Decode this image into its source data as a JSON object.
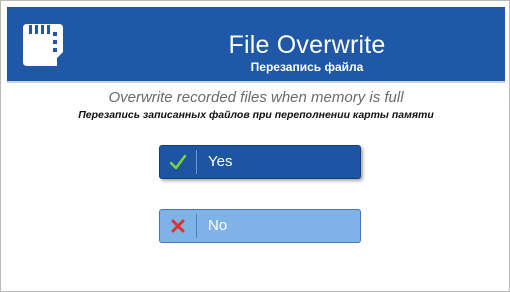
{
  "dialog": {
    "title": "File Overwrite",
    "subtitle": "Перезапись файла",
    "icon": "sd-card-icon",
    "description_en": "Overwrite recorded files when memory is full",
    "description_ru": "Перезапись записанных файлов при переполнении карты памяти"
  },
  "options": [
    {
      "label": "Yes",
      "icon": "check-icon",
      "selected": true
    },
    {
      "label": "No",
      "icon": "cross-icon",
      "selected": false
    }
  ],
  "colors": {
    "header": "#1f58a7",
    "selected_option": "#1e55a3",
    "unselected_option": "#7fb2e6",
    "check": "#7ed23a",
    "cross": "#e0322c"
  }
}
